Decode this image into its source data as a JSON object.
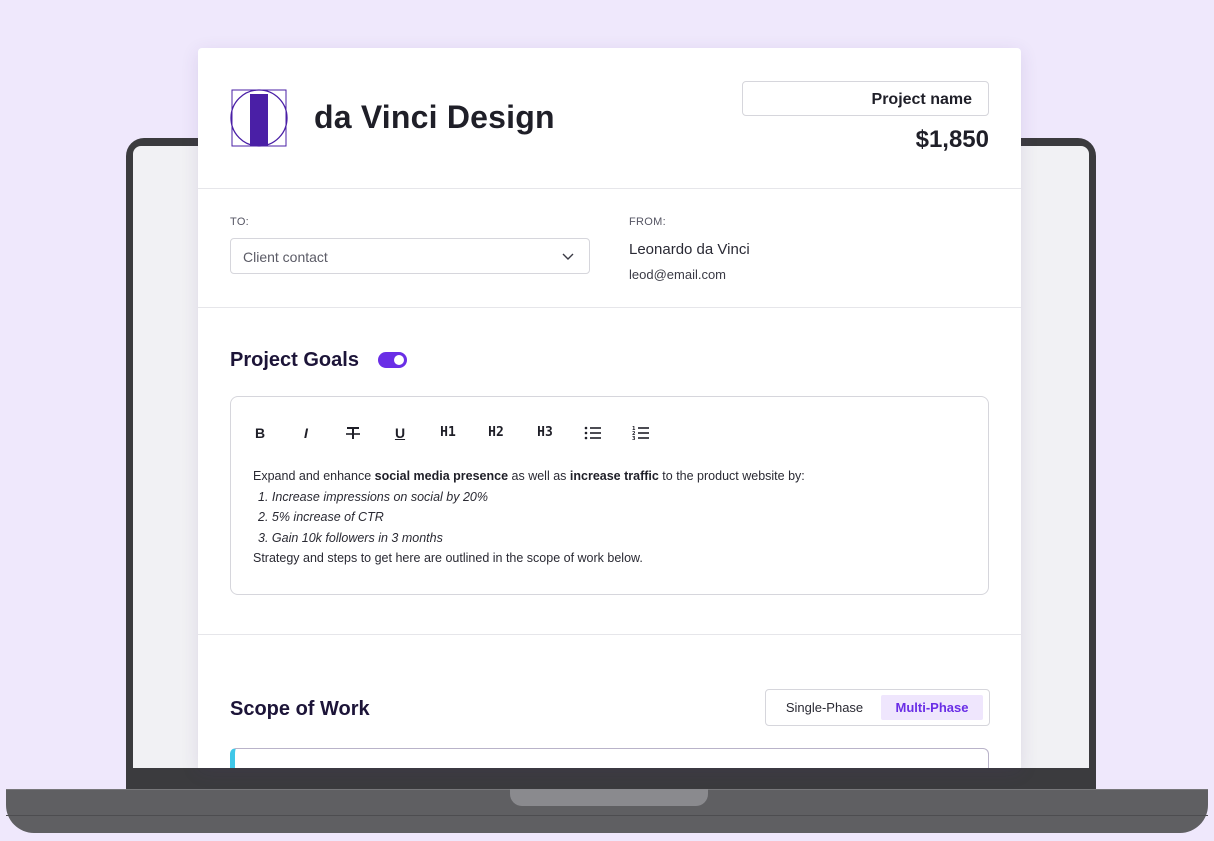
{
  "brand": {
    "name": "da Vinci Design",
    "logo_color": "#4a1fa6"
  },
  "header": {
    "project_name": "Project name",
    "price": "$1,850"
  },
  "parties": {
    "to_label": "TO:",
    "client_placeholder": "Client contact",
    "from_label": "FROM:",
    "from_name": "Leonardo da Vinci",
    "from_email": "leod@email.com"
  },
  "goals": {
    "title": "Project Goals",
    "toggle_on": true,
    "toolbar": [
      "B",
      "I",
      "S",
      "U",
      "H1",
      "H2",
      "H3",
      "bulleted-list",
      "numbered-list"
    ],
    "intro_prefix": "Expand and enhance ",
    "intro_bold1": "social media presence",
    "intro_mid": " as well as ",
    "intro_bold2": "increase traffic",
    "intro_suffix": " to the product website by:",
    "items": [
      "1. Increase impressions on social by 20%",
      "2. 5% increase of CTR",
      "3. Gain 10k followers in 3 months"
    ],
    "closing": "Strategy and steps to get here are outlined in the scope of work below."
  },
  "scope": {
    "title": "Scope of Work",
    "phase_single": "Single-Phase",
    "phase_multi": "Multi-Phase",
    "selected": "Multi-Phase"
  },
  "colors": {
    "accent": "#6a2ee6",
    "background": "#efe8fc",
    "scope_stripe": "#3fc7e8"
  }
}
